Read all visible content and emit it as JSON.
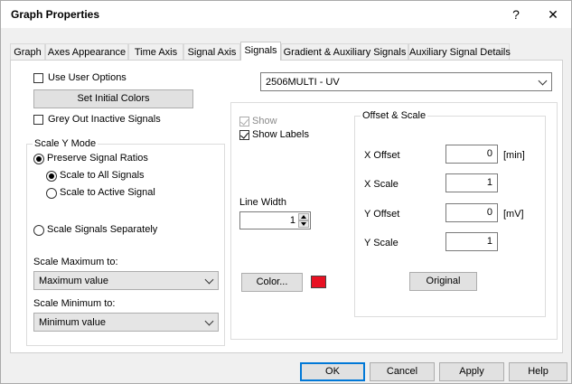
{
  "window": {
    "title": "Graph Properties",
    "help_glyph": "?",
    "close_glyph": "✕"
  },
  "tabs": [
    {
      "label": "Graph"
    },
    {
      "label": "Axes Appearance"
    },
    {
      "label": "Time Axis"
    },
    {
      "label": "Signal Axis"
    },
    {
      "label": "Signals"
    },
    {
      "label": "Gradient & Auxiliary Signals"
    },
    {
      "label": "Auxiliary Signal Details"
    }
  ],
  "left": {
    "use_user_options": {
      "label": "Use User Options",
      "checked": false
    },
    "set_initial_colors": "Set Initial Colors",
    "grey_out": {
      "label": "Grey Out Inactive Signals",
      "checked": false
    },
    "scale_y_mode": {
      "title": "Scale Y Mode",
      "preserve_ratios": "Preserve Signal Ratios",
      "scale_all": "Scale to All Signals",
      "scale_active": "Scale to Active Signal",
      "scale_separately": "Scale Signals Separately",
      "scale_max_label": "Scale Maximum to:",
      "scale_max_value": "Maximum value",
      "scale_min_label": "Scale Minimum to:",
      "scale_min_value": "Minimum value"
    }
  },
  "signal_select": {
    "value": "2506MULTI - UV"
  },
  "right": {
    "show": {
      "label": "Show",
      "checked": true
    },
    "show_labels": {
      "label": "Show Labels",
      "checked": true
    },
    "line_width": {
      "label": "Line Width",
      "value": "1"
    },
    "color_button": "Color...",
    "color_value": "#e81123",
    "offset_scale": {
      "title": "Offset & Scale",
      "x_offset": {
        "label": "X Offset",
        "value": "0",
        "unit": "[min]"
      },
      "x_scale": {
        "label": "X Scale",
        "value": "1"
      },
      "y_offset": {
        "label": "Y Offset",
        "value": "0",
        "unit": "[mV]"
      },
      "y_scale": {
        "label": "Y Scale",
        "value": "1"
      },
      "original": "Original"
    }
  },
  "footer": {
    "ok": "OK",
    "cancel": "Cancel",
    "apply": "Apply",
    "help": "Help"
  }
}
